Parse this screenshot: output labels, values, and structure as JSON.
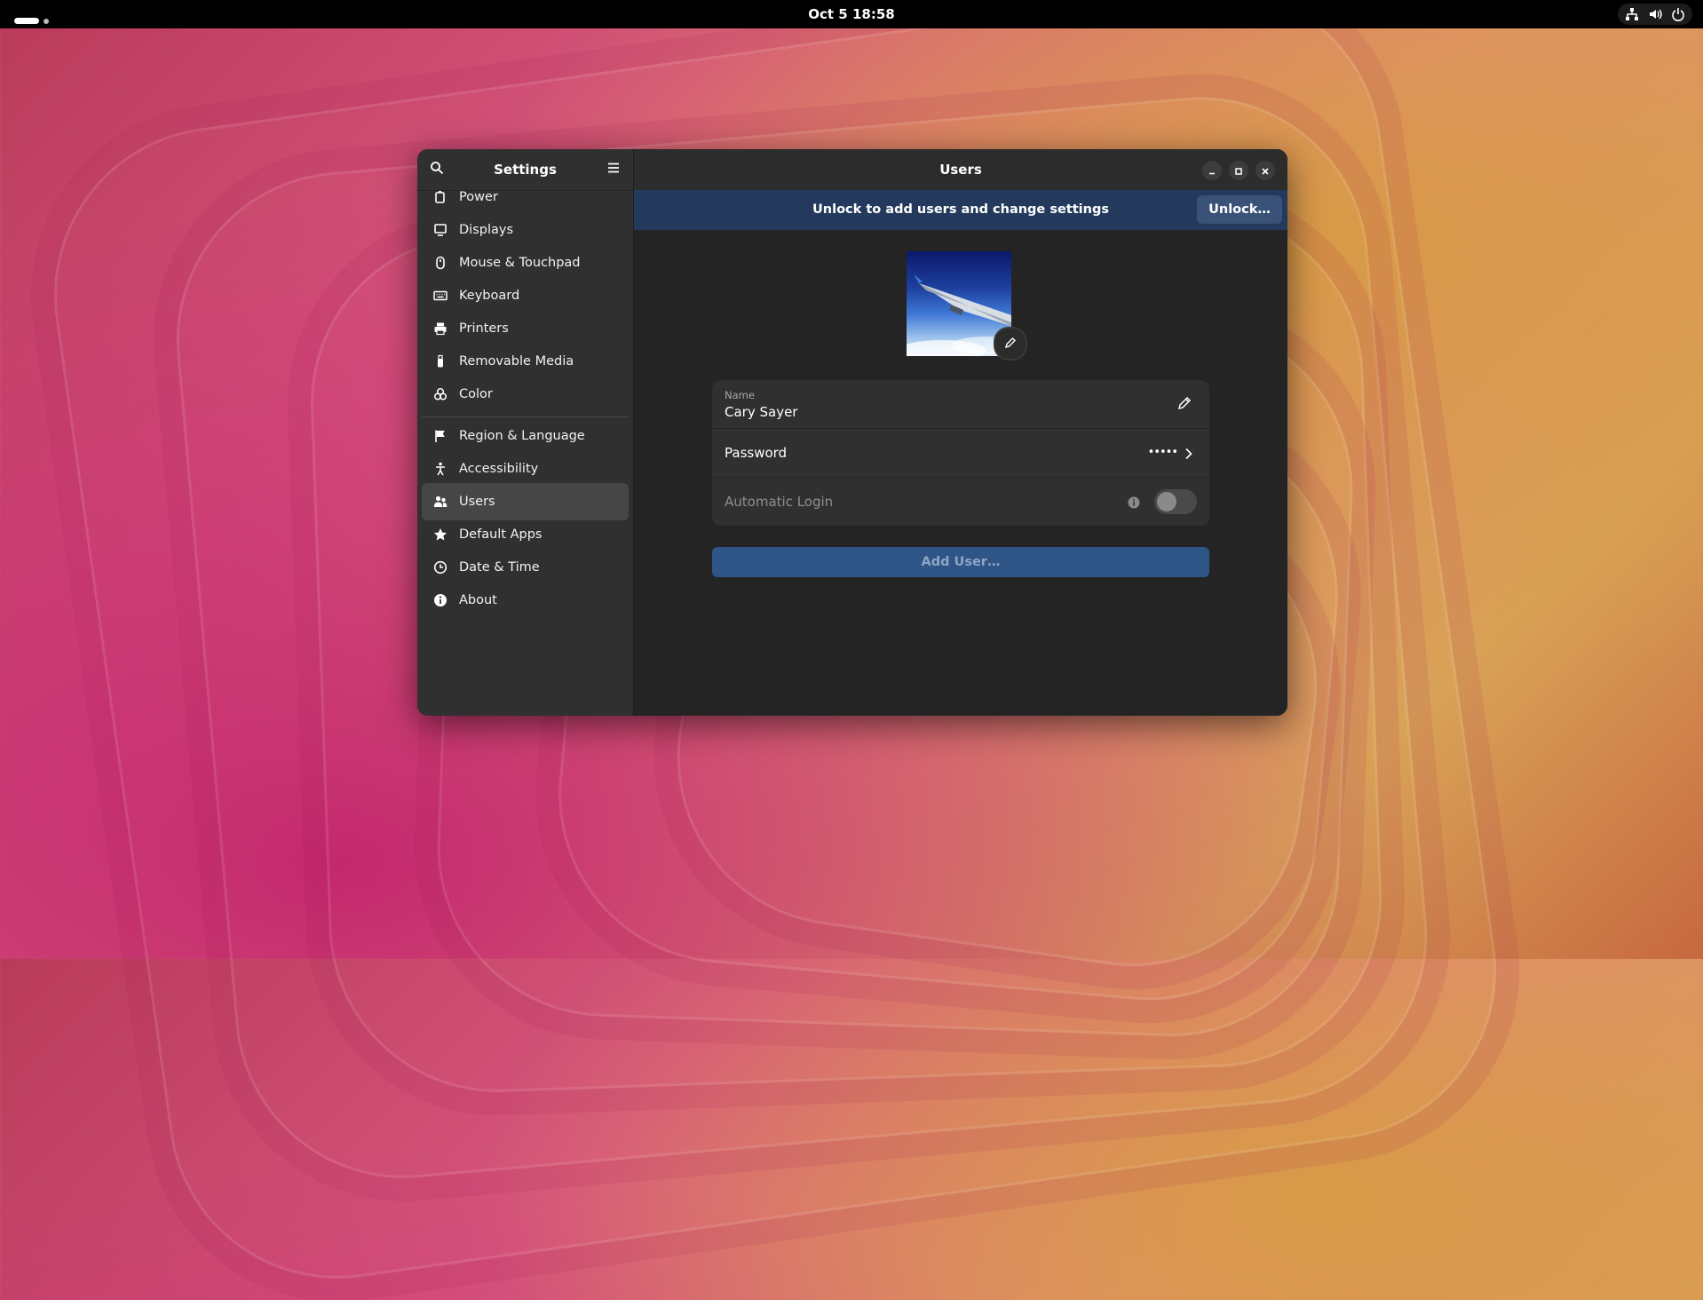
{
  "topbar": {
    "clock": "Oct 5  18:58"
  },
  "window": {
    "sidebar_title": "Settings",
    "main_title": "Users",
    "sidebar": {
      "items": [
        {
          "label": "Power",
          "icon": "power-icon"
        },
        {
          "label": "Displays",
          "icon": "display-icon"
        },
        {
          "label": "Mouse & Touchpad",
          "icon": "mouse-icon"
        },
        {
          "label": "Keyboard",
          "icon": "keyboard-icon"
        },
        {
          "label": "Printers",
          "icon": "printer-icon"
        },
        {
          "label": "Removable Media",
          "icon": "usb-icon"
        },
        {
          "label": "Color",
          "icon": "color-icon"
        },
        {
          "label": "Region & Language",
          "icon": "flag-icon"
        },
        {
          "label": "Accessibility",
          "icon": "accessibility-icon"
        },
        {
          "label": "Users",
          "icon": "users-icon",
          "active": true
        },
        {
          "label": "Default Apps",
          "icon": "star-icon"
        },
        {
          "label": "Date & Time",
          "icon": "clock-icon"
        },
        {
          "label": "About",
          "icon": "info-icon"
        }
      ]
    },
    "banner": {
      "text": "Unlock to add users and change settings",
      "button": "Unlock…"
    },
    "user": {
      "name_label": "Name",
      "name": "Cary Sayer",
      "password_label": "Password",
      "password_mask": "•••••",
      "auto_login_label": "Automatic Login",
      "auto_login_enabled": false
    },
    "add_user_button": "Add User…"
  },
  "colors": {
    "banner_bg": "#233a5c",
    "accent": "#2f5486",
    "window_bg": "#242424",
    "sidebar_bg": "#303030"
  }
}
